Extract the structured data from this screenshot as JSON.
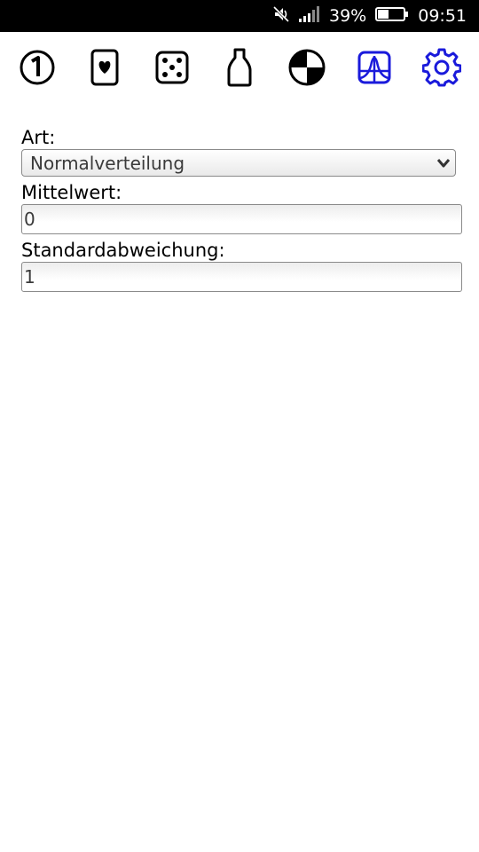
{
  "status_bar": {
    "battery_percent": "39%",
    "time": "09:51",
    "icons": [
      "mute-icon",
      "signal-icon",
      "battery-icon"
    ]
  },
  "toolbar": {
    "items": [
      {
        "icon": "number-one-icon",
        "active": false
      },
      {
        "icon": "playing-card-heart-icon",
        "active": false
      },
      {
        "icon": "dice-five-icon",
        "active": false
      },
      {
        "icon": "bottle-icon",
        "active": false
      },
      {
        "icon": "spinner-wheel-icon",
        "active": false
      },
      {
        "icon": "distribution-curve-icon",
        "active": true
      },
      {
        "icon": "settings-gear-icon",
        "active": true
      }
    ],
    "active_color": "#1a1adb",
    "inactive_color": "#000000"
  },
  "form": {
    "type_label": "Art:",
    "type_value": "Normalverteilung",
    "mean_label": "Mittelwert:",
    "mean_value": "0",
    "stddev_label": "Standardabweichung:",
    "stddev_value": "1"
  }
}
